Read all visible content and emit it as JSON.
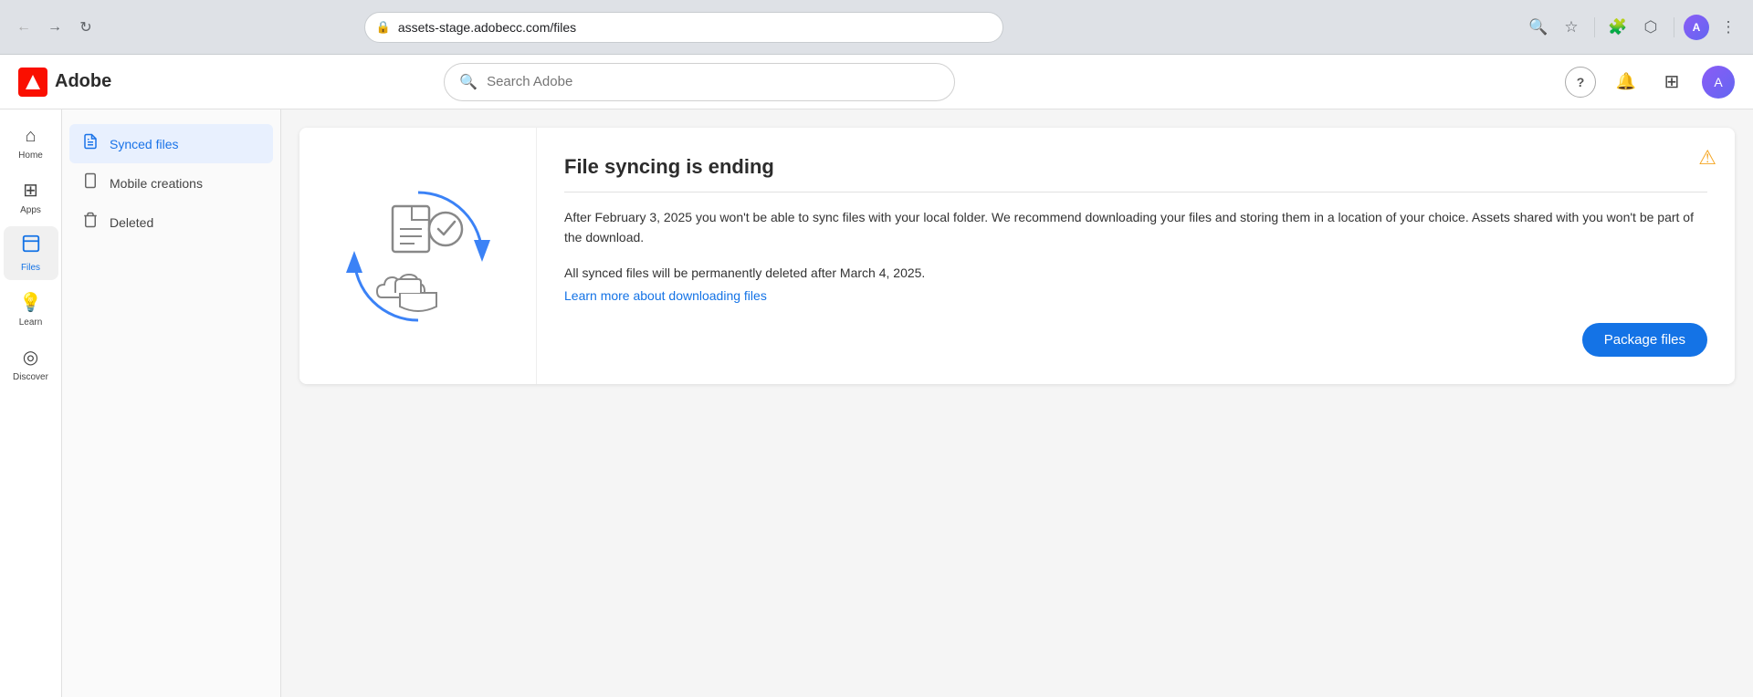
{
  "browser": {
    "back_btn": "←",
    "forward_btn": "→",
    "refresh_btn": "↻",
    "url": "assets-stage.adobecc.com/files",
    "search_icon": "🔍",
    "star_icon": "☆",
    "extensions_icon": "🧩",
    "menu_icon": "⋮"
  },
  "header": {
    "logo_text": "Adobe",
    "search_placeholder": "Search Adobe",
    "help_icon": "?",
    "bell_icon": "🔔",
    "grid_icon": "⊞"
  },
  "sidebar_icons": [
    {
      "id": "home",
      "icon": "⌂",
      "label": "Home",
      "active": false
    },
    {
      "id": "apps",
      "icon": "⊞",
      "label": "Apps",
      "active": false
    },
    {
      "id": "files",
      "icon": "📄",
      "label": "Files",
      "active": true
    },
    {
      "id": "learn",
      "icon": "💡",
      "label": "Learn",
      "active": false
    },
    {
      "id": "discover",
      "icon": "◎",
      "label": "Discover",
      "active": false
    }
  ],
  "left_nav": {
    "items": [
      {
        "id": "synced-files",
        "icon": "📄",
        "label": "Synced files",
        "active": true
      },
      {
        "id": "mobile-creations",
        "icon": "📱",
        "label": "Mobile creations",
        "active": false
      },
      {
        "id": "deleted",
        "icon": "🗑",
        "label": "Deleted",
        "active": false
      }
    ]
  },
  "banner": {
    "title": "File syncing is ending",
    "warning_icon": "⚠",
    "divider": true,
    "main_text": "After February 3, 2025 you won't be able to sync files with your local folder. We recommend downloading your files and storing them in a location of your choice. Assets shared with you won't be part of the download.",
    "secondary_text": "All synced files will be permanently deleted after March 4, 2025.",
    "learn_link_text": "Learn more about downloading files",
    "package_btn_label": "Package files"
  }
}
